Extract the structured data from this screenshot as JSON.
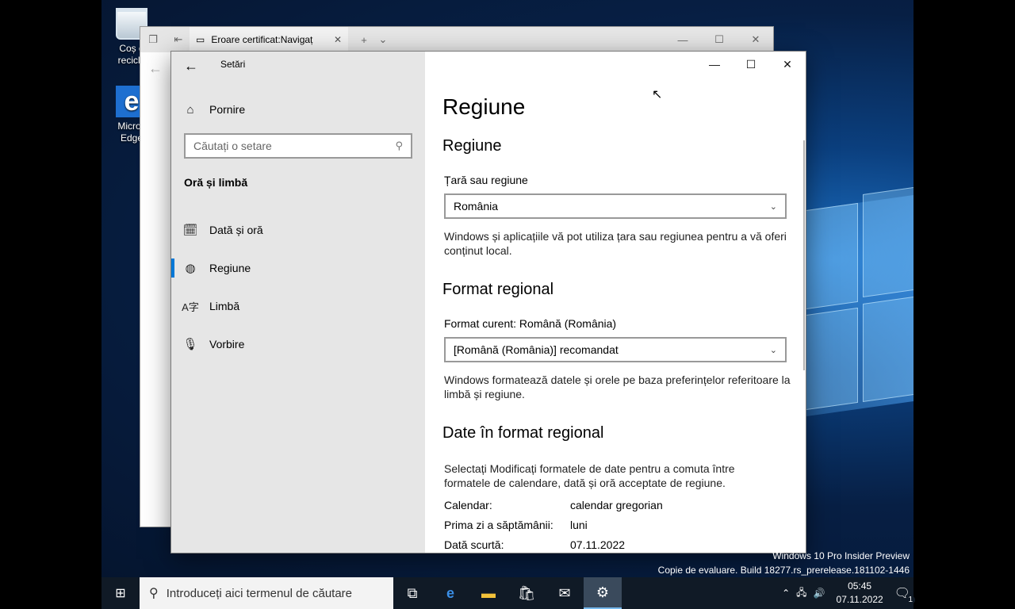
{
  "desktop": {
    "icons": [
      {
        "label_line1": "Coș d",
        "label_line2": "recicla"
      },
      {
        "label_line1": "Micros",
        "label_line2": "Edge"
      }
    ],
    "watermark_line1": "Windows 10 Pro Insider Preview",
    "watermark_line2": "Copie de evaluare. Build 18277.rs_prerelease.181102-1446"
  },
  "browser": {
    "tab_title": "Eroare certificat:Navigaț",
    "tab_close_icon": "close-icon",
    "new_tab_icon": "plus-icon"
  },
  "settings": {
    "app_title": "Setări",
    "home_label": "Pornire",
    "search_placeholder": "Căutați o setare",
    "group_header": "Oră și limbă",
    "nav_items": [
      {
        "label": "Dată și oră",
        "icon": "calendar-clock-icon"
      },
      {
        "label": "Regiune",
        "icon": "globe-icon",
        "active": true
      },
      {
        "label": "Limbă",
        "icon": "language-icon"
      },
      {
        "label": "Vorbire",
        "icon": "microphone-icon"
      }
    ],
    "page_title": "Regiune",
    "region_section": {
      "heading": "Regiune",
      "country_label": "Țară sau regiune",
      "country_value": "România",
      "description": "Windows și aplicațiile vă pot utiliza țara sau regiunea pentru a vă oferi conținut local."
    },
    "format_section": {
      "heading": "Format regional",
      "current_label": "Format curent: Română (România)",
      "format_value": "[Română (România)] recomandat",
      "description": "Windows formatează datele și orele pe baza preferințelor referitoare la limbă și regiune."
    },
    "dates_section": {
      "heading": "Date în format regional",
      "description": "Selectați Modificați formatele de date pentru a comuta între formatele de calendare, dată și oră acceptate de regiune.",
      "rows": [
        {
          "key": "Calendar:",
          "value": "calendar gregorian"
        },
        {
          "key": "Prima zi a săptămânii:",
          "value": "luni"
        },
        {
          "key": "Dată scurtă:",
          "value": "07.11.2022"
        }
      ]
    }
  },
  "taskbar": {
    "search_placeholder": "Introduceți aici termenul de căutare",
    "time": "05:45",
    "date": "07.11.2022",
    "notification_count": "1"
  },
  "colors": {
    "accent": "#0078d7",
    "taskbar": "#101a26",
    "nav_bg": "#e6e6e6"
  }
}
